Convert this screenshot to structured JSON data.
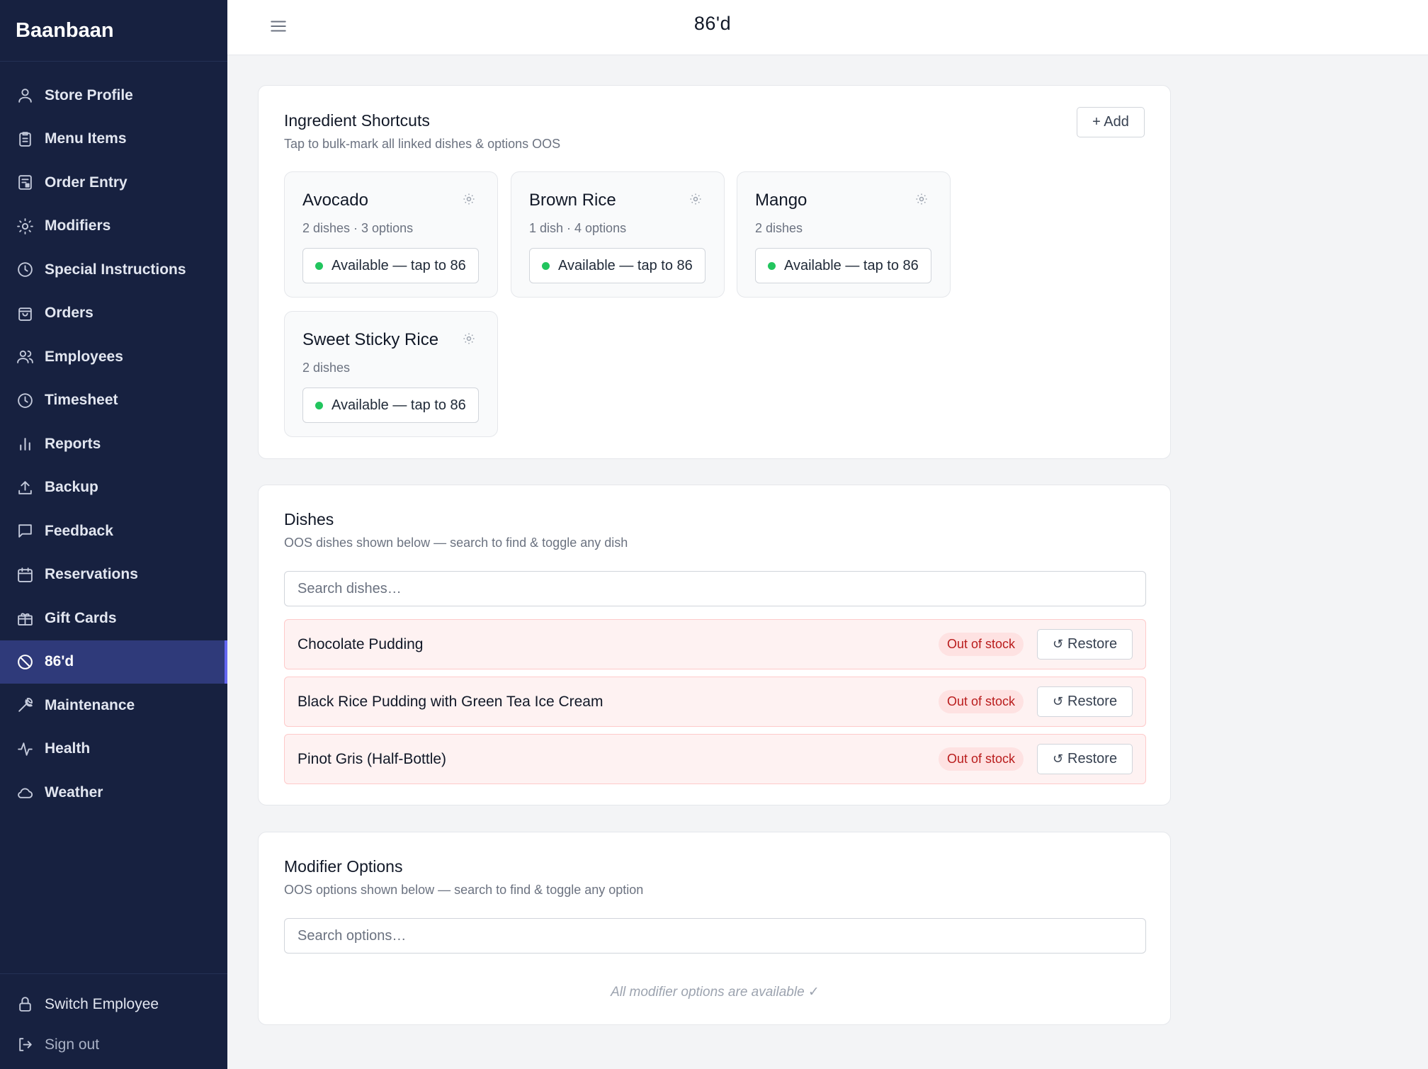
{
  "app": {
    "name": "Baanbaan"
  },
  "header": {
    "title": "86'd"
  },
  "sidebar": {
    "items": [
      {
        "label": "Store Profile",
        "icon": "user-icon"
      },
      {
        "label": "Menu Items",
        "icon": "clipboard-icon"
      },
      {
        "label": "Order Entry",
        "icon": "order-entry-icon"
      },
      {
        "label": "Modifiers",
        "icon": "sun-icon"
      },
      {
        "label": "Special Instructions",
        "icon": "clock-icon"
      },
      {
        "label": "Orders",
        "icon": "bag-icon"
      },
      {
        "label": "Employees",
        "icon": "users-icon"
      },
      {
        "label": "Timesheet",
        "icon": "clock-icon"
      },
      {
        "label": "Reports",
        "icon": "bar-chart-icon"
      },
      {
        "label": "Backup",
        "icon": "upload-icon"
      },
      {
        "label": "Feedback",
        "icon": "message-icon"
      },
      {
        "label": "Reservations",
        "icon": "calendar-icon"
      },
      {
        "label": "Gift Cards",
        "icon": "gift-icon"
      },
      {
        "label": "86'd",
        "icon": "ban-icon",
        "active": true
      },
      {
        "label": "Maintenance",
        "icon": "wrench-icon"
      },
      {
        "label": "Health",
        "icon": "activity-icon"
      },
      {
        "label": "Weather",
        "icon": "cloud-icon"
      }
    ],
    "footer": {
      "switch_employee": "Switch Employee",
      "sign_out": "Sign out"
    }
  },
  "ingredients": {
    "title": "Ingredient Shortcuts",
    "subtitle": "Tap to bulk-mark all linked dishes & options OOS",
    "add_label": "+ Add",
    "items": [
      {
        "name": "Avocado",
        "meta": "2 dishes · 3 options",
        "status": "Available — tap to 86"
      },
      {
        "name": "Brown Rice",
        "meta": "1 dish · 4 options",
        "status": "Available — tap to 86"
      },
      {
        "name": "Mango",
        "meta": "2 dishes",
        "status": "Available — tap to 86"
      },
      {
        "name": "Sweet Sticky Rice",
        "meta": "2 dishes",
        "status": "Available — tap to 86"
      }
    ]
  },
  "dishes": {
    "title": "Dishes",
    "subtitle": "OOS dishes shown below — search to find & toggle any dish",
    "search_placeholder": "Search dishes…",
    "items": [
      {
        "name": "Chocolate Pudding",
        "badge": "Out of stock",
        "action": "Restore"
      },
      {
        "name": "Black Rice Pudding with Green Tea Ice Cream",
        "badge": "Out of stock",
        "action": "Restore"
      },
      {
        "name": "Pinot Gris (Half-Bottle)",
        "badge": "Out of stock",
        "action": "Restore"
      }
    ]
  },
  "modifiers": {
    "title": "Modifier Options",
    "subtitle": "OOS options shown below — search to find & toggle any option",
    "search_placeholder": "Search options…",
    "empty_text": "All modifier options are available ✓"
  },
  "colors": {
    "sidebar_bg": "#172140",
    "active_bg": "#2f3a7a",
    "available_dot": "#22c55e",
    "oos_bg": "#fef2f2",
    "oos_text": "#b91c1c"
  }
}
